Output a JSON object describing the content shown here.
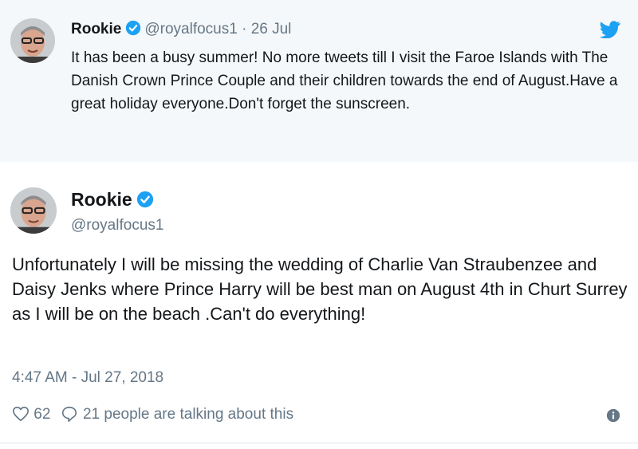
{
  "parent_tweet": {
    "author_name": "Rookie",
    "handle": "@royalfocus1",
    "separator": "·",
    "date": "26 Jul",
    "text": "It has been a busy summer! No more tweets till I visit the Faroe Islands with The Danish Crown Prince Couple and their children towards the end of August.Have a great holiday everyone.Don't forget the sunscreen.",
    "icons": [
      "avatar",
      "verified-badge-icon",
      "twitter-bird-icon"
    ]
  },
  "main_tweet": {
    "author_name": "Rookie",
    "handle": "@royalfocus1",
    "text": "Unfortunately I will be missing the wedding of Charlie Van Straubenzee and Daisy Jenks where Prince Harry will be best man on August 4th in Churt Surrey as I will be on the beach .Can't do everything!",
    "timestamp": "4:47 AM - Jul 27, 2018",
    "likes": "62",
    "talking": "21 people are talking about this",
    "icons": [
      "avatar",
      "verified-badge-icon",
      "heart-icon",
      "comment-icon",
      "info-icon"
    ]
  },
  "colors": {
    "accent": "#1da1f2",
    "parent_background": "#f5f8fa",
    "text": "#14171a",
    "muted": "#657786"
  }
}
